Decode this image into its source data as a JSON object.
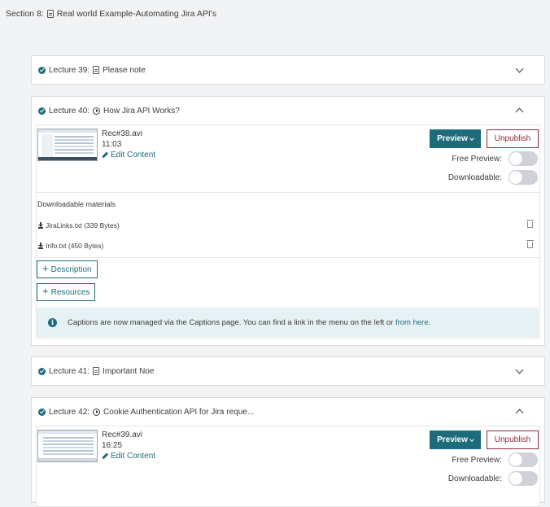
{
  "section": {
    "label": "Section 8:",
    "title": "Real world Example-Automating Jira API's"
  },
  "lectures": [
    {
      "label": "Lecture 39:",
      "title": "Please note",
      "type": "article"
    },
    {
      "label": "Lecture 40:",
      "title": "How Jira API Works?",
      "type": "video",
      "file": {
        "name": "Rec#38.avi",
        "duration": "11:03"
      },
      "edit_label": "Edit Content",
      "preview_label": "Preview",
      "unpublish_label": "Unpublish",
      "free_preview_label": "Free Preview:",
      "downloadable_label": "Downloadable:",
      "downloadable_title": "Downloadable materials",
      "materials": [
        "JiraLinks.txt (339 Bytes)",
        "Info.txt (450 Bytes)"
      ],
      "description_label": "Description",
      "resources_label": "Resources",
      "captions_text": "Captions are now managed via the Captions page. You can find a link in the menu on the left or ",
      "captions_link": "from here",
      "captions_end": "."
    },
    {
      "label": "Lecture 41:",
      "title": "Important Noe",
      "type": "article"
    },
    {
      "label": "Lecture 42:",
      "title": "Cookie Authentication API for Jira reque...",
      "type": "video",
      "file": {
        "name": "Rec#39.avi",
        "duration": "16:25"
      },
      "edit_label": "Edit Content",
      "preview_label": "Preview",
      "unpublish_label": "Unpublish",
      "free_preview_label": "Free Preview:",
      "downloadable_label": "Downloadable:"
    }
  ],
  "colors": {
    "accent": "#1e6c7b",
    "danger": "#8d2a3a",
    "info_bg": "#e6f1f4"
  }
}
